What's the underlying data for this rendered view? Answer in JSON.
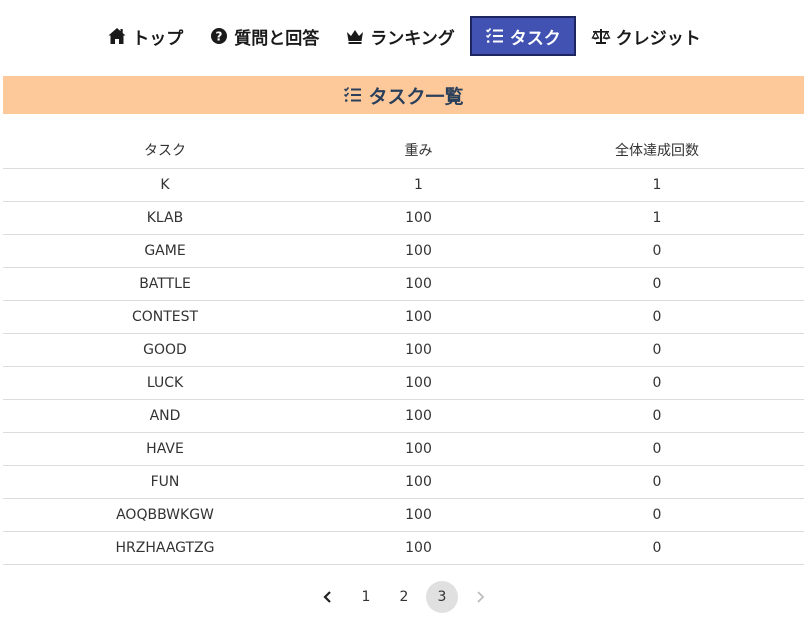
{
  "nav": {
    "items": [
      {
        "label": "トップ",
        "icon": "home-icon"
      },
      {
        "label": "質問と回答",
        "icon": "question-circle-icon"
      },
      {
        "label": "ランキング",
        "icon": "crown-icon"
      },
      {
        "label": "タスク",
        "icon": "checklist-icon",
        "active": true
      },
      {
        "label": "クレジット",
        "icon": "balance-scale-icon"
      }
    ]
  },
  "section": {
    "title": "タスク一覧",
    "icon": "checklist-icon",
    "background": "#fdc99b"
  },
  "table": {
    "headers": [
      "タスク",
      "重み",
      "全体達成回数"
    ],
    "rows": [
      [
        "K",
        "1",
        "1"
      ],
      [
        "KLAB",
        "100",
        "1"
      ],
      [
        "GAME",
        "100",
        "0"
      ],
      [
        "BATTLE",
        "100",
        "0"
      ],
      [
        "CONTEST",
        "100",
        "0"
      ],
      [
        "GOOD",
        "100",
        "0"
      ],
      [
        "LUCK",
        "100",
        "0"
      ],
      [
        "AND",
        "100",
        "0"
      ],
      [
        "HAVE",
        "100",
        "0"
      ],
      [
        "FUN",
        "100",
        "0"
      ],
      [
        "AOQBBWKGW",
        "100",
        "0"
      ],
      [
        "HRZHAAGTZG",
        "100",
        "0"
      ]
    ]
  },
  "pagination": {
    "pages": [
      "1",
      "2",
      "3"
    ],
    "current": "3",
    "prev_icon": "chevron-left-icon",
    "next_icon": "chevron-right-icon"
  },
  "colors": {
    "accent": "#4152b3",
    "header_bg": "#fdc99b"
  }
}
